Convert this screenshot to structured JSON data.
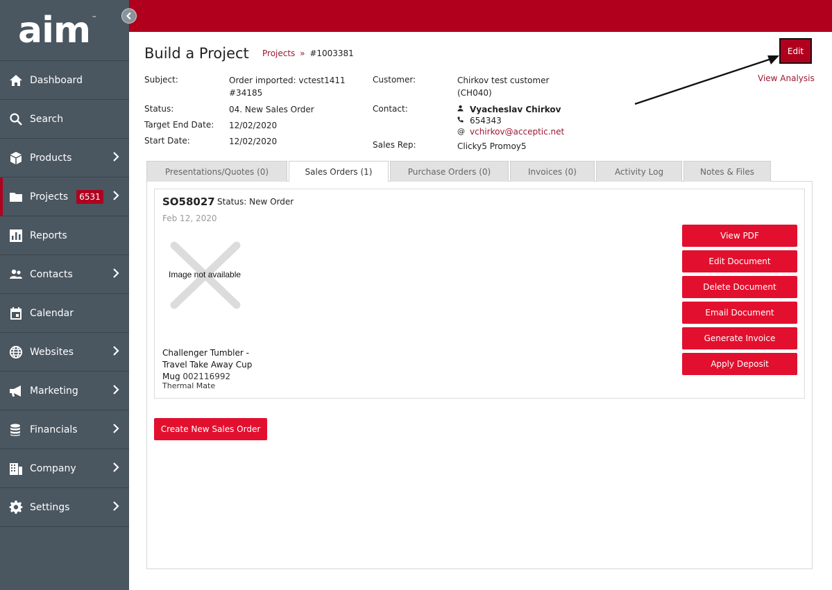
{
  "brand": {
    "logo_text": "aim",
    "logo_tm": "™"
  },
  "sidebar": {
    "items": [
      {
        "label": "Dashboard",
        "icon": "home-icon"
      },
      {
        "label": "Search",
        "icon": "search-icon"
      },
      {
        "label": "Products",
        "icon": "box-icon"
      },
      {
        "label": "Projects",
        "icon": "folder-icon",
        "badge": "6531"
      },
      {
        "label": "Reports",
        "icon": "bar-chart-icon"
      },
      {
        "label": "Contacts",
        "icon": "people-icon"
      },
      {
        "label": "Calendar",
        "icon": "calendar-icon"
      },
      {
        "label": "Websites",
        "icon": "globe-icon"
      },
      {
        "label": "Marketing",
        "icon": "megaphone-icon"
      },
      {
        "label": "Financials",
        "icon": "coins-icon"
      },
      {
        "label": "Company",
        "icon": "building-icon"
      },
      {
        "label": "Settings",
        "icon": "gear-icon"
      }
    ]
  },
  "header": {
    "title": "Build a Project",
    "breadcrumb_link": "Projects",
    "breadcrumb_sep": "»",
    "breadcrumb_current": "#1003381",
    "edit_label": "Edit",
    "view_analysis": "View Analysis"
  },
  "details": {
    "subject_label": "Subject:",
    "subject_line1": "Order imported: vctest1411",
    "subject_line2": "#34185",
    "status_label": "Status:",
    "status_value": "04. New Sales Order",
    "target_end_label": "Target End Date:",
    "target_end_value": "12/02/2020",
    "start_label": "Start Date:",
    "start_value": "12/02/2020",
    "customer_label": "Customer:",
    "customer_line1": "Chirkov test customer",
    "customer_line2": "(CH040)",
    "contact_label": "Contact:",
    "contact_name": "Vyacheslav Chirkov",
    "contact_phone": "654343",
    "contact_email_prefix": "@",
    "contact_email": "vchirkov@acceptic.net",
    "sales_rep_label": "Sales Rep:",
    "sales_rep_value": "Clicky5 Promoy5"
  },
  "tabs": [
    "Presentations/Quotes (0)",
    "Sales Orders (1)",
    "Purchase Orders (0)",
    "Invoices (0)",
    "Activity Log",
    "Notes & Files"
  ],
  "active_tab_index": 1,
  "sales_order": {
    "number": "SO58027",
    "status": "Status: New Order",
    "date": "Feb 12, 2020",
    "image_placeholder": "Image not available",
    "product_line1": "Challenger Tumbler -",
    "product_line2": "Travel Take Away Cup",
    "product_line3": "Mug",
    "product_sku": "002116992",
    "product_brand": "Thermal Mate",
    "buttons": {
      "view_pdf": "View PDF",
      "edit_document": "Edit Document",
      "delete_document": "Delete Document",
      "email_document": "Email Document",
      "generate_invoice": "Generate Invoice",
      "apply_deposit": "Apply Deposit"
    }
  },
  "create_new_label": "Create New Sales Order",
  "colors": {
    "brand_red": "#b0001e",
    "button_red": "#e2102e",
    "sidebar_bg": "#4a5660",
    "link": "#9b1730"
  }
}
